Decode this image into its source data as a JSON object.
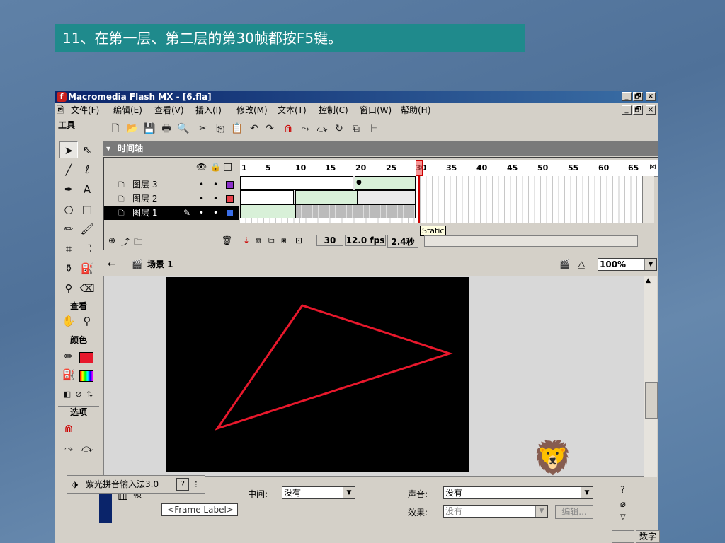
{
  "caption": "11、在第一层、第二层的第30帧都按F5键。",
  "window": {
    "title": "Macromedia Flash MX - [6.fla]",
    "controls": [
      "_",
      "🗗",
      "×"
    ]
  },
  "menu": [
    "文件(F)",
    "编辑(E)",
    "查看(V)",
    "插入(I)",
    "修改(M)",
    "文本(T)",
    "控制(C)",
    "窗口(W)",
    "帮助(H)"
  ],
  "tools_panel": {
    "title": "工具",
    "view_label": "查看",
    "colors_label": "颜色",
    "options_label": "选项",
    "stroke_color": "#e8182c",
    "fill_color": "#e8182c"
  },
  "timeline": {
    "title": "时间轴",
    "frame_numbers": [
      "1",
      "5",
      "10",
      "15",
      "20",
      "25",
      "30",
      "35",
      "40",
      "45",
      "50",
      "55",
      "60",
      "65"
    ],
    "layers": [
      {
        "name": "图层 3",
        "color": "#8b2fc9",
        "selected": false
      },
      {
        "name": "图层 2",
        "color": "#e8404a",
        "selected": false
      },
      {
        "name": "图层 1",
        "color": "#3a6ee8",
        "selected": true
      }
    ],
    "current_frame": "30",
    "fps": "12.0 fps",
    "elapsed": "2.4秒",
    "tooltip": "Static"
  },
  "stage": {
    "scene": "场景 1",
    "zoom": "100%",
    "triangle_color": "#e8182c"
  },
  "properties": {
    "frame_label": "帧",
    "frame_label_placeholder": "<Frame Label>",
    "tween_label": "中间:",
    "tween_value": "没有",
    "sound_label": "声音:",
    "sound_value": "没有",
    "effect_label": "效果:",
    "effect_value": "没有",
    "edit_button": "编辑..."
  },
  "ime": {
    "name": "紫光拼音输入法3.0"
  },
  "status": {
    "num": "数字"
  }
}
